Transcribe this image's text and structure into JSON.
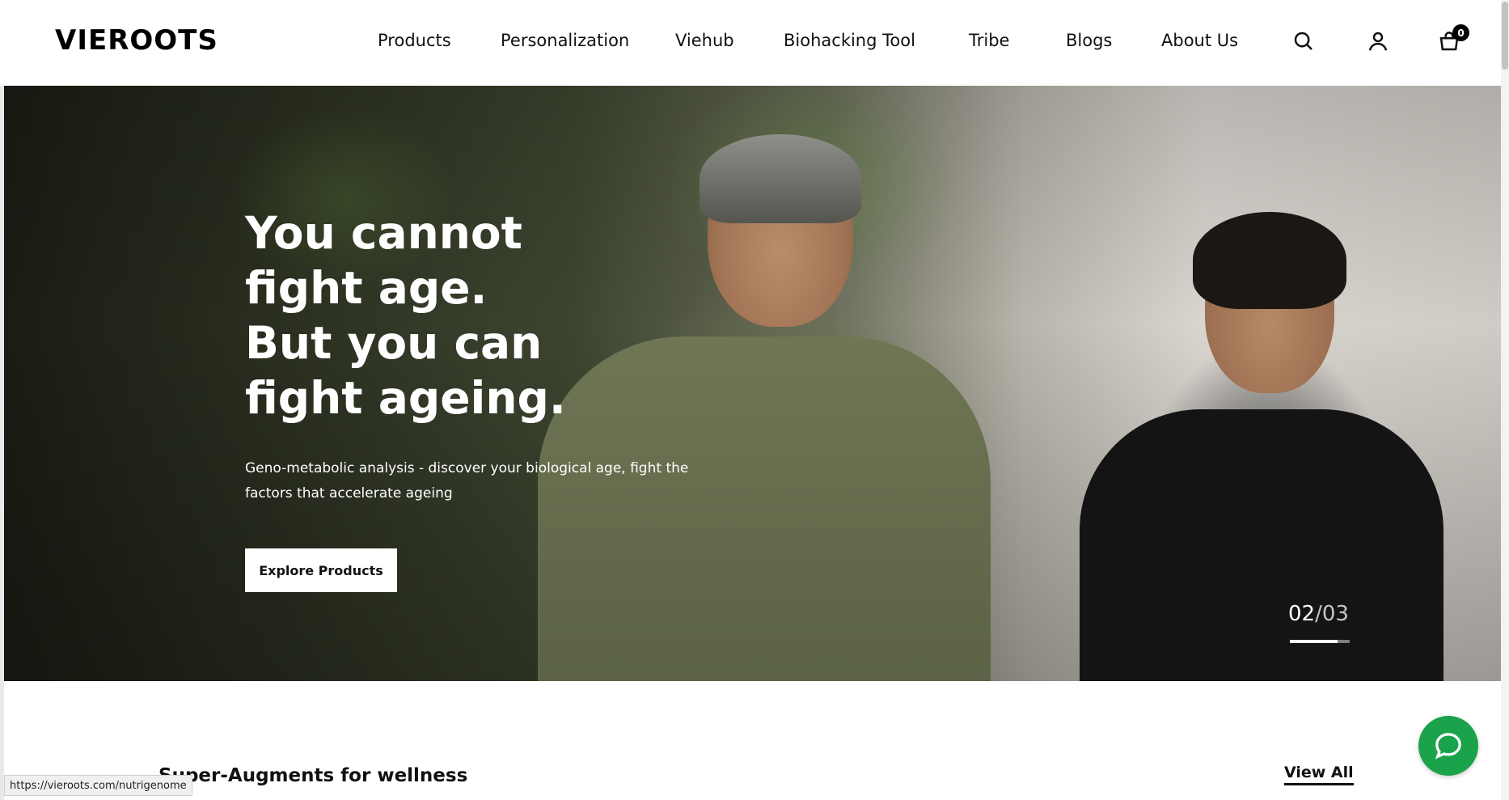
{
  "brand": {
    "logo": "VIEROOTS"
  },
  "nav": {
    "items": [
      {
        "label": "Products"
      },
      {
        "label": "Personalization"
      },
      {
        "label": "Viehub"
      },
      {
        "label": "Biohacking Tool"
      },
      {
        "label": "Tribe"
      },
      {
        "label": "Blogs"
      },
      {
        "label": "About Us"
      }
    ],
    "icons": {
      "search": "search-icon",
      "account": "user-icon",
      "cart": "bag-icon"
    },
    "cart_count": "0"
  },
  "hero": {
    "title_lines": [
      "You cannot",
      "fight age.",
      "But you can",
      "fight ageing."
    ],
    "subtitle_lines": [
      "Geno-metabolic analysis - discover your biological age, fight the",
      "factors that accelerate ageing"
    ],
    "cta_label": "Explore Products",
    "slide_current": "02",
    "slide_separator": "/",
    "slide_total": "03",
    "slide_progress": 0.8
  },
  "section": {
    "title": "Super-Augments for wellness",
    "view_all_label": "View All"
  },
  "status_bar": {
    "url": "https://vieroots.com/nutrigenome"
  },
  "colors": {
    "chat_green": "#1aa34a",
    "text_dark": "#111111",
    "white": "#ffffff"
  }
}
